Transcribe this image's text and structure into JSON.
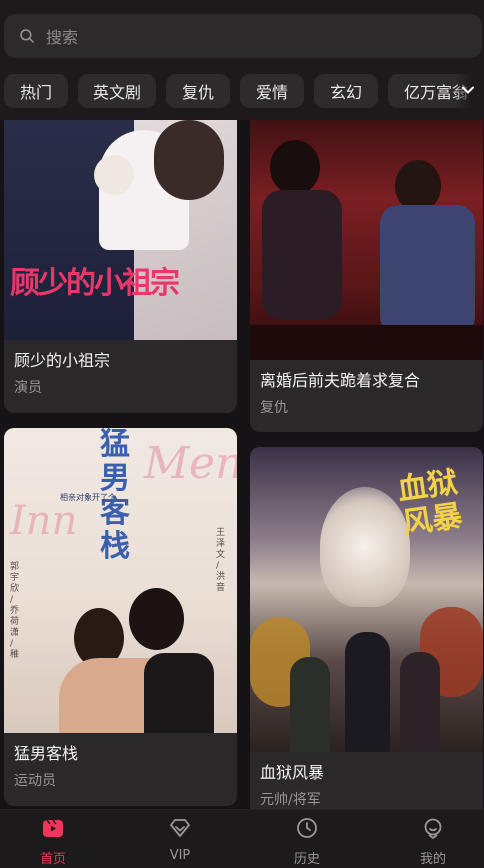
{
  "search": {
    "placeholder": "搜索"
  },
  "categories": [
    "热门",
    "英文剧",
    "复仇",
    "爱情",
    "玄幻",
    "亿万富翁"
  ],
  "dramas": [
    {
      "title": "顾少的小祖宗",
      "tag": "演员",
      "poster_text": "顾少的小祖宗"
    },
    {
      "title": "离婚后前夫跪着求复合",
      "tag": "复仇"
    },
    {
      "title": "猛男客栈",
      "tag": "运动员",
      "poster_text": "猛男客栈",
      "poster_sub": "相亲对象开了个",
      "poster_cast_left": "郭宇欣 / 乔荷潇 / 稚",
      "poster_cast_right": "王泽文 / 洪音"
    },
    {
      "title": "血狱风暴",
      "tag": "元帅/将军",
      "poster_text": "血狱风暴"
    }
  ],
  "nav": [
    {
      "label": "首页",
      "icon": "home-clapper-icon",
      "active": true
    },
    {
      "label": "VIP",
      "icon": "diamond-icon",
      "active": false
    },
    {
      "label": "历史",
      "icon": "clock-icon",
      "active": false
    },
    {
      "label": "我的",
      "icon": "user-icon",
      "active": false
    }
  ],
  "colors": {
    "accent": "#f0365a",
    "background": "#151315",
    "card": "#2b2829"
  }
}
